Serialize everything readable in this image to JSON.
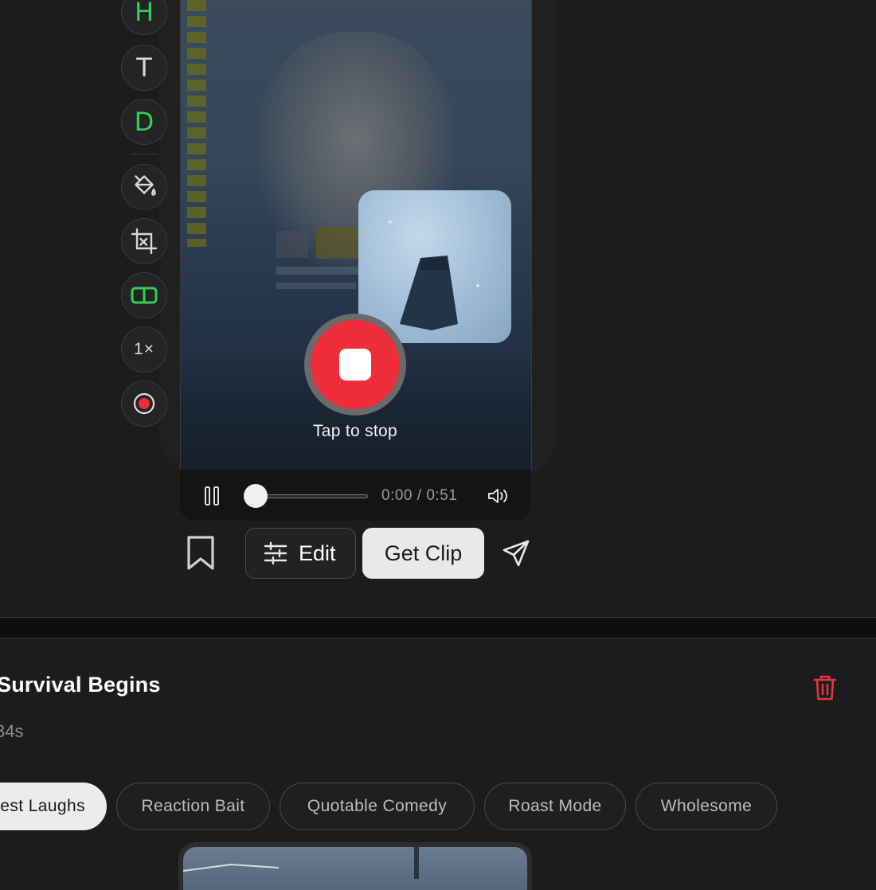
{
  "tools": {
    "highlight_letter": "H",
    "text_letter": "T",
    "draw_letter": "D",
    "speed_label": "1×"
  },
  "recorder": {
    "stop_label": "Tap to stop"
  },
  "player": {
    "time": "0:00 / 0:51",
    "progress": 0
  },
  "actions": {
    "edit_label": "Edit",
    "get_clip_label": "Get Clip"
  },
  "clip": {
    "title": "Survival Begins",
    "duration": "34s"
  },
  "chips": [
    {
      "label": "est Laughs",
      "active": true
    },
    {
      "label": "Reaction Bait",
      "active": false
    },
    {
      "label": "Quotable Comedy",
      "active": false
    },
    {
      "label": "Roast Mode",
      "active": false
    },
    {
      "label": "Wholesome",
      "active": false
    }
  ],
  "colors": {
    "accent_green": "#2ed158",
    "record_red": "#ee2d3b",
    "delete_red": "#e8333f"
  }
}
